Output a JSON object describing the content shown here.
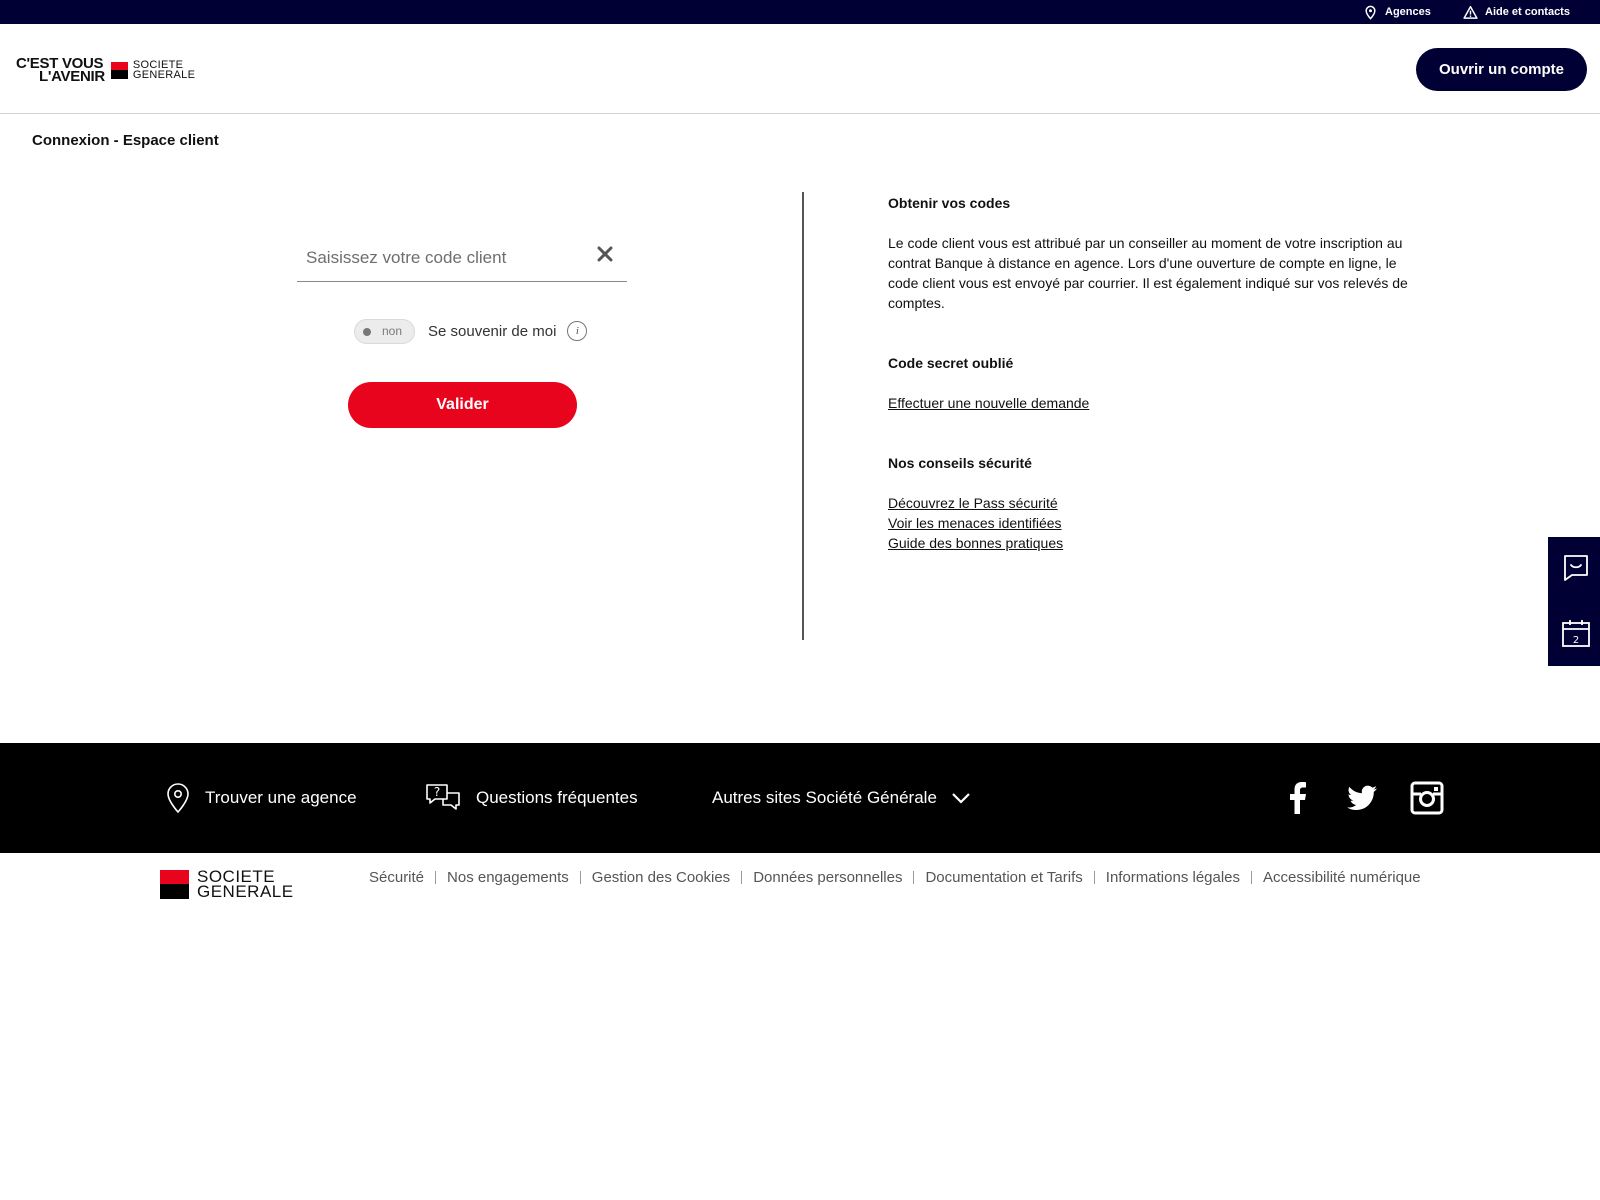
{
  "topbar": {
    "agences_label": "Agences",
    "aide_label": "Aide et contacts"
  },
  "header": {
    "slogan_line1": "C'EST VOUS",
    "slogan_line2": "L'AVENIR",
    "brand_line1": "SOCIETE",
    "brand_line2": "GENERALE",
    "open_account_label": "Ouvrir un compte"
  },
  "page": {
    "title": "Connexion - Espace client"
  },
  "login": {
    "code_placeholder": "Saisissez votre code client",
    "code_value": "",
    "toggle_state": "non",
    "remember_label": "Se souvenir de moi",
    "info_glyph": "i",
    "submit_label": "Valider"
  },
  "info": {
    "codes_title": "Obtenir vos codes",
    "codes_text": "Le code client vous est attribué par un conseiller au moment de votre inscription au contrat Banque à distance en agence. Lors d'une ouverture de compte en ligne, le code client vous est envoyé par courrier. Il est également indiqué sur vos relevés de comptes.",
    "secret_title": "Code secret oublié",
    "secret_link": "Effectuer une nouvelle demande",
    "security_title": "Nos conseils sécurité",
    "security_links": [
      "Découvrez le Pass sécurité",
      "Voir les menaces identifiées",
      "Guide des bonnes pratiques"
    ]
  },
  "side_widget": {
    "chat_icon": "chat-smile-icon",
    "calendar_icon": "calendar-icon",
    "calendar_digit": "2"
  },
  "footer": {
    "find_agency": "Trouver une agence",
    "faq": "Questions fréquentes",
    "other_sites": "Autres sites Société Générale",
    "brand_line1": "SOCIETE",
    "brand_line2": "GENERALE",
    "legal_links": [
      "Sécurité",
      "Nos engagements",
      "Gestion des Cookies",
      "Données personnelles",
      "Documentation et Tarifs",
      "Informations légales",
      "Accessibilité numérique"
    ]
  },
  "colors": {
    "navy": "#010035",
    "red": "#e9041e",
    "black": "#000000"
  }
}
